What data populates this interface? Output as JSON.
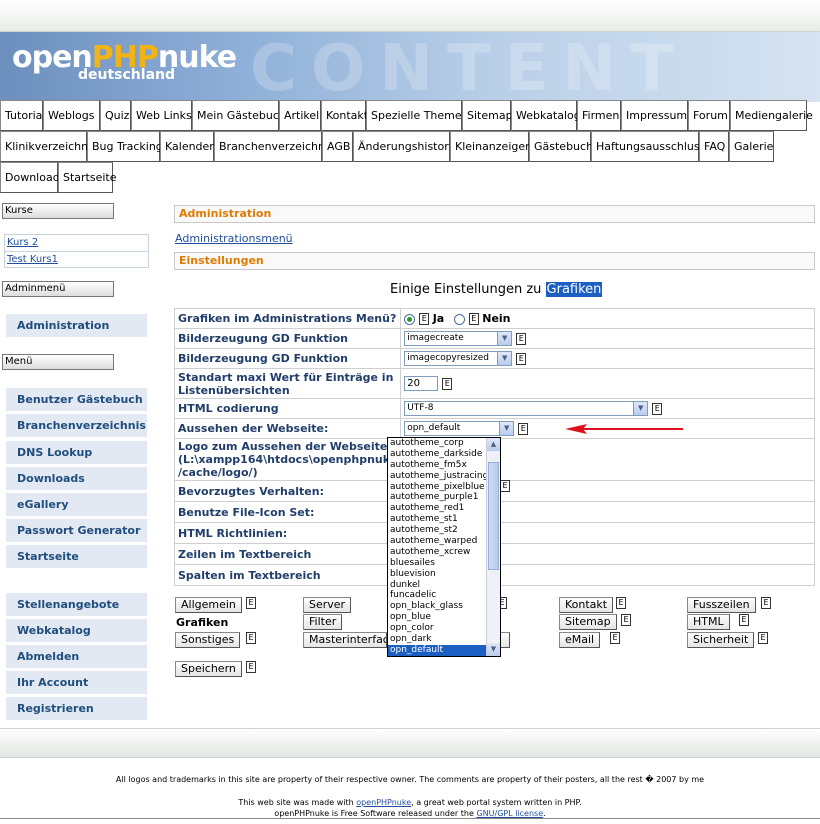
{
  "banner": {
    "logo_open": "open",
    "logo_php": "PHP",
    "logo_nuke": "nuke",
    "logo_sub": "deutschland",
    "ghost_text": "CONTENT"
  },
  "nav": {
    "row1": [
      "Tutorial",
      "Weblogs",
      "Quiz",
      "Web Links",
      "Mein Gästebuch",
      "Artikel",
      "Kontakt",
      "Spezielle Themen",
      "Sitemap",
      "Webkatalog",
      "Firmen",
      "Impressum",
      "Forum",
      "Mediengalerie"
    ],
    "row2": [
      "Klinikverzeichnis",
      "Bug Tracking",
      "Kalender",
      "Branchenverzeichnis",
      "AGB",
      "Änderungshistorie",
      "Kleinanzeigen",
      "Gästebuch",
      "Haftungsausschluss",
      "FAQ",
      "Galerie"
    ],
    "row3": [
      "Download",
      "Startseite"
    ]
  },
  "sidebar": {
    "kurse_title": "Kurse",
    "kurse_links": [
      "Kurs 2",
      "Test Kurs1"
    ],
    "adminmenu_title": "Adminmenü",
    "admin_item": "Administration",
    "menu_title": "Menü",
    "menu_items": [
      "Benutzer Gästebuch",
      "Branchenverzeichnis",
      "DNS Lookup",
      "Downloads",
      "eGallery",
      "Passwort Generator",
      "Startseite"
    ],
    "menu_items2": [
      "Stellenangebote",
      "Webkatalog",
      "Abmelden",
      "Ihr Account",
      "Registrieren"
    ]
  },
  "main": {
    "admin_header": "Administration",
    "admin_menu_link": "Administrationsmenü",
    "settings_header": "Einstellungen",
    "title_pre": "Einige Einstellungen zu",
    "title_sel": "Grafiken",
    "rows": {
      "r1_label": "Grafiken im Administrations Menü?",
      "r1_yes": "Ja",
      "r1_no": "Nein",
      "r2_label": "Bilderzeugung GD Funktion",
      "r2_value": "imagecreate",
      "r3_label": "Bilderzeugung GD Funktion",
      "r3_value": "imagecopyresized",
      "r4_label": "Standart maxi Wert für Einträge in Listenübersichten",
      "r4_value": "20",
      "r5_label": "HTML codierung",
      "r5_value": "UTF-8",
      "r6_label": "Aussehen der Webseite:",
      "r6_value": "opn_default",
      "r7_label": "Logo zum Aussehen der Webseite: (L:\\xampp164\\htdocs\\openphpnuke /cache/logo/)",
      "r8_label": "Bevorzugtes Verhalten:",
      "r9_label": "Benutze File-Icon Set:",
      "r10_label": "HTML Richtlinien:",
      "r11_label": "Zeilen im Textbereich",
      "r12_label": "Spalten im Textbereich"
    },
    "dropdown_options": [
      "autotheme_corp",
      "autotheme_darkside",
      "autotheme_fm5x",
      "autotheme_justracing",
      "autotheme_pixelblue",
      "autotheme_purple1",
      "autotheme_red1",
      "autotheme_st1",
      "autotheme_st2",
      "autotheme_warped",
      "autotheme_xcrew",
      "bluesailes",
      "bluevision",
      "dunkel",
      "funcadelic",
      "opn_black_glass",
      "opn_blue",
      "opn_color",
      "opn_dark",
      "opn_default"
    ],
    "dropdown_selected": "opn_default",
    "buttons": {
      "allgemein": "Allgemein",
      "grafiken": "Grafiken",
      "sonstiges": "Sonstiges",
      "speichern": "Speichern",
      "server": "Server",
      "filter": "Filter",
      "masterinterface": "Masterinterface",
      "kontakt": "Kontakt",
      "sitemap": "Sitemap",
      "email": "eMail",
      "fusszeilen": "Fusszeilen",
      "html": "HTML",
      "sicherheit": "Sicherheit"
    },
    "doc_glyph": "E"
  },
  "footer": {
    "line1": "All logos and trademarks in this site are property of their respective owner. The comments are property of their posters, all the rest � 2007 by me",
    "line2_pre": "This web site was made with",
    "line2_link": "openPHPnuke",
    "line2_post": ", a great web portal system written in PHP.",
    "line3_pre": "openPHPnuke is Free Software released under the",
    "line3_link": "GNU/GPL license",
    "line3_post": "."
  },
  "colors": {
    "accent": "#e07b00",
    "link": "#1f4e9b",
    "selection": "#1c5fc2",
    "arrow": "#e0101a"
  }
}
